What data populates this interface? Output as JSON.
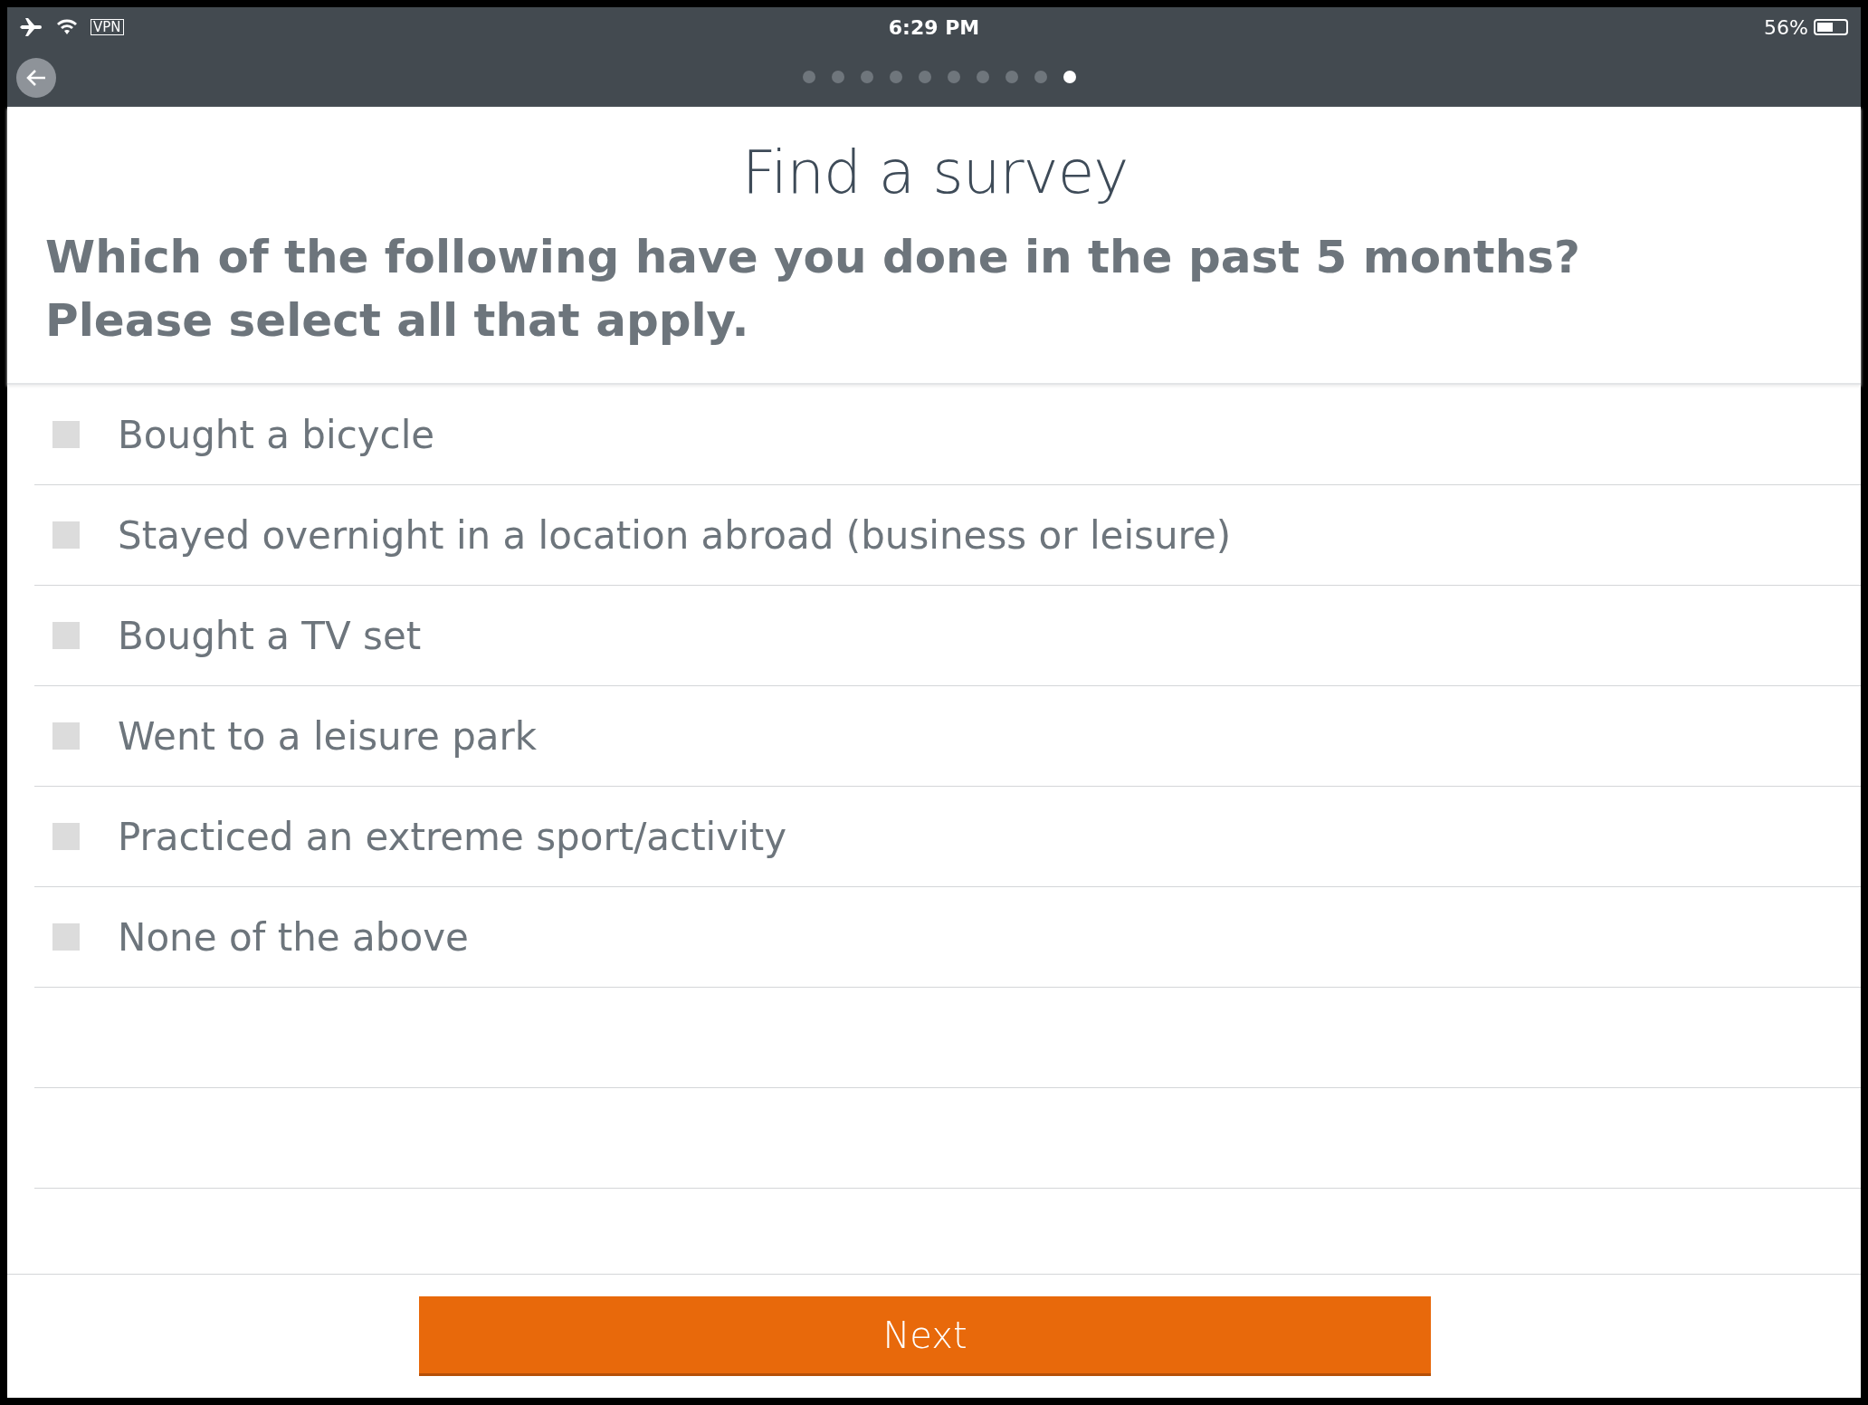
{
  "status_bar": {
    "vpn": "VPN",
    "time": "6:29 PM",
    "battery": "56%"
  },
  "pager": [
    {
      "selected": false
    },
    {
      "selected": false
    },
    {
      "selected": false
    },
    {
      "selected": false
    },
    {
      "selected": false
    },
    {
      "selected": false
    },
    {
      "selected": false
    },
    {
      "selected": false
    },
    {
      "selected": false
    },
    {
      "selected": true
    }
  ],
  "title": "Find a survey",
  "question": "Which of the following have you done in the past 5 months? Please select all that apply.",
  "options": [
    {
      "label": "Bought a bicycle",
      "checked": false
    },
    {
      "label": "Stayed overnight in a location abroad (business or leisure)",
      "checked": false
    },
    {
      "label": "Bought a TV set",
      "checked": false
    },
    {
      "label": "Went to a leisure park",
      "checked": false
    },
    {
      "label": "Practiced an extreme sport/activity",
      "checked": false
    },
    {
      "label": "None of the above",
      "checked": false
    }
  ],
  "next_button": "Next"
}
